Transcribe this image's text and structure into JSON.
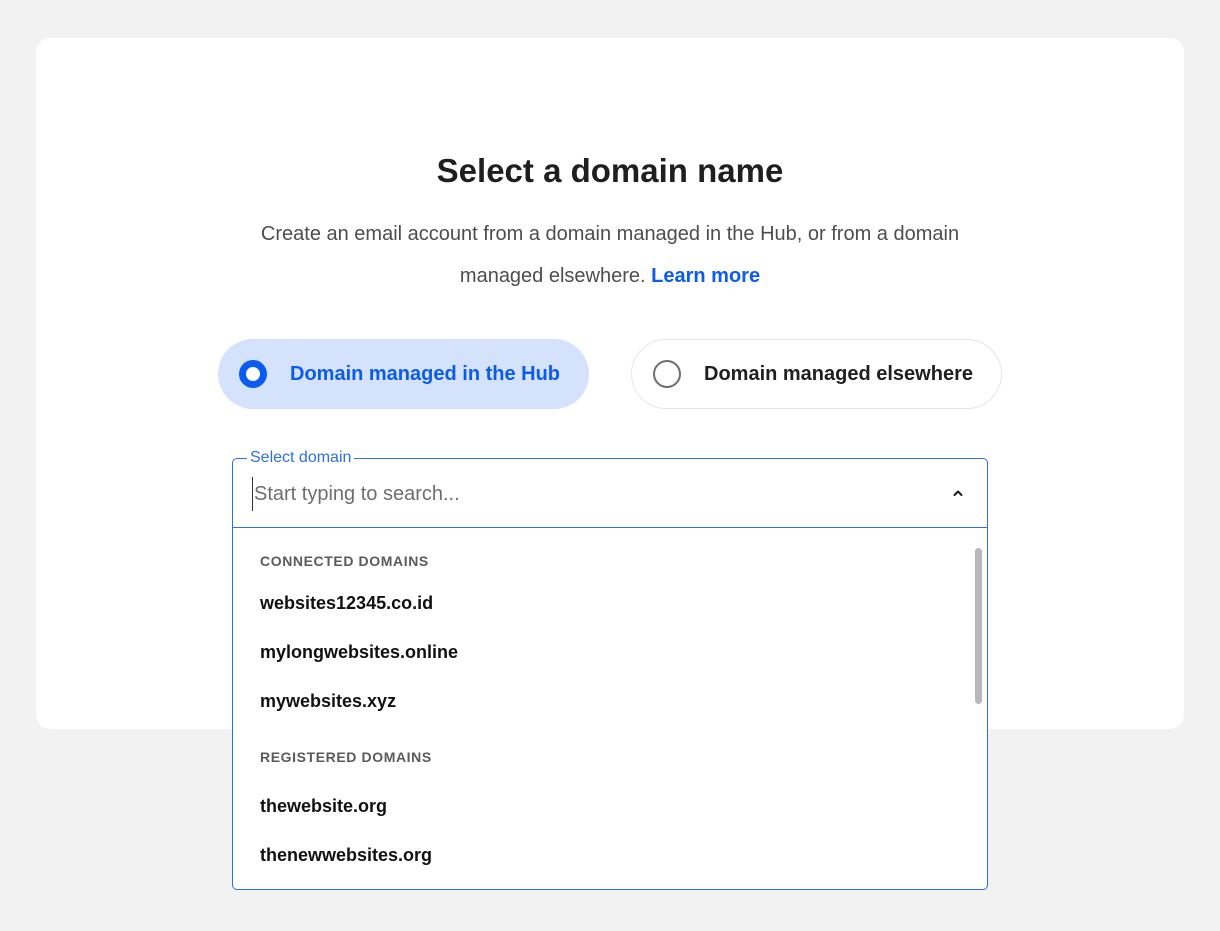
{
  "heading": {
    "title": "Select a domain name",
    "subtitle": "Create an email account from a domain managed in the Hub, or from a domain managed elsewhere.",
    "learn_more": "Learn more"
  },
  "options": {
    "hub": {
      "label": "Domain managed in the Hub",
      "selected": true
    },
    "elsewhere": {
      "label": "Domain managed elsewhere",
      "selected": false
    }
  },
  "select": {
    "label": "Select domain",
    "placeholder": "Start typing to search...",
    "value": ""
  },
  "groups": [
    {
      "header": "CONNECTED DOMAINS",
      "items": [
        "websites12345.co.id",
        "mylongwebsites.online",
        "mywebsites.xyz"
      ]
    },
    {
      "header": "REGISTERED DOMAINS",
      "items": [
        "thewebsite.org",
        "thenewwebsites.org"
      ]
    }
  ],
  "colors": {
    "accent": "#0a5cf0",
    "selected_bg": "#d5e2fc",
    "field_border": "#2d6fe8",
    "page_bg": "#f2f2f2"
  },
  "icons": {
    "dropdown_toggle": "chevron-up-icon"
  }
}
